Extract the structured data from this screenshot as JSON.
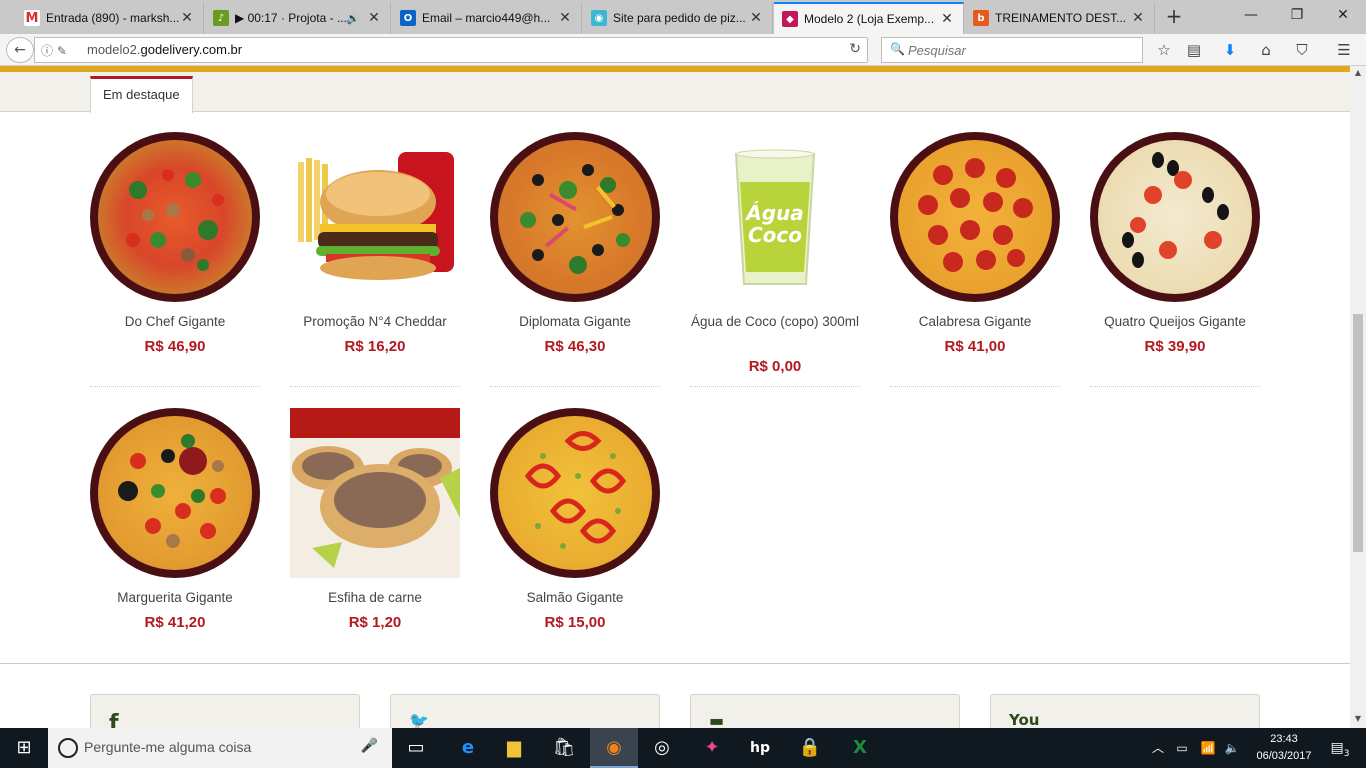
{
  "browser": {
    "tabs": [
      {
        "title": "Entrada (890) - marksh...",
        "icon": "gmail-icon",
        "color": "#d93025"
      },
      {
        "title": "▶ 00:17 · Projota - ...",
        "icon": "music-icon",
        "color": "#6a9a1e",
        "audio": true
      },
      {
        "title": "Email – marcio449@h...",
        "icon": "outlook-icon",
        "color": "#0a64c8"
      },
      {
        "title": "Site para pedido de piz...",
        "icon": "site-icon",
        "color": "#3fb6d2"
      },
      {
        "title": "Modelo 2 (Loja Exemp...",
        "icon": "godelivery-icon",
        "color": "#c2185b",
        "active": true
      },
      {
        "title": "TREINAMENTO DEST...",
        "icon": "training-icon",
        "color": "#e65a1e"
      }
    ],
    "new_tab": "+",
    "url_prefix": "modelo2.",
    "url_domain": "godelivery.com.br",
    "search_placeholder": "Pesquisar"
  },
  "page": {
    "tab_label": "Em destaque",
    "products": [
      {
        "name": "Do Chef Gigante",
        "price": "R$ 46,90",
        "kind": "pizza",
        "theme": "chef"
      },
      {
        "name": "Promoção N°4 Cheddar",
        "price": "R$ 16,20",
        "kind": "combo",
        "theme": "burger"
      },
      {
        "name": "Diplomata Gigante",
        "price": "R$ 46,30",
        "kind": "pizza",
        "theme": "diplomata"
      },
      {
        "name": "Água de Coco (copo) 300ml",
        "price": "R$ 0,00",
        "kind": "cup",
        "theme": "coco",
        "cup_label": "Água Coco"
      },
      {
        "name": "Calabresa Gigante",
        "price": "R$ 41,00",
        "kind": "pizza",
        "theme": "calabresa"
      },
      {
        "name": "Quatro Queijos Gigante",
        "price": "R$ 39,90",
        "kind": "pizza",
        "theme": "queijos"
      },
      {
        "name": "Marguerita Gigante",
        "price": "R$ 41,20",
        "kind": "pizza",
        "theme": "marguerita"
      },
      {
        "name": "Esfiha de carne",
        "price": "R$ 1,20",
        "kind": "photo",
        "theme": "esfiha"
      },
      {
        "name": "Salmão Gigante",
        "price": "R$ 15,00",
        "kind": "pizza",
        "theme": "salmao"
      }
    ],
    "social": [
      {
        "icon": "facebook-icon",
        "glyph": "f"
      },
      {
        "icon": "twitter-icon",
        "glyph": "🐦"
      },
      {
        "icon": "email-icon",
        "glyph": "▬"
      },
      {
        "icon": "youtube-icon",
        "glyph": "You"
      }
    ]
  },
  "taskbar": {
    "search_placeholder": "Pergunte-me alguma coisa",
    "time": "23:43",
    "date": "06/03/2017",
    "notification_count": "3"
  }
}
